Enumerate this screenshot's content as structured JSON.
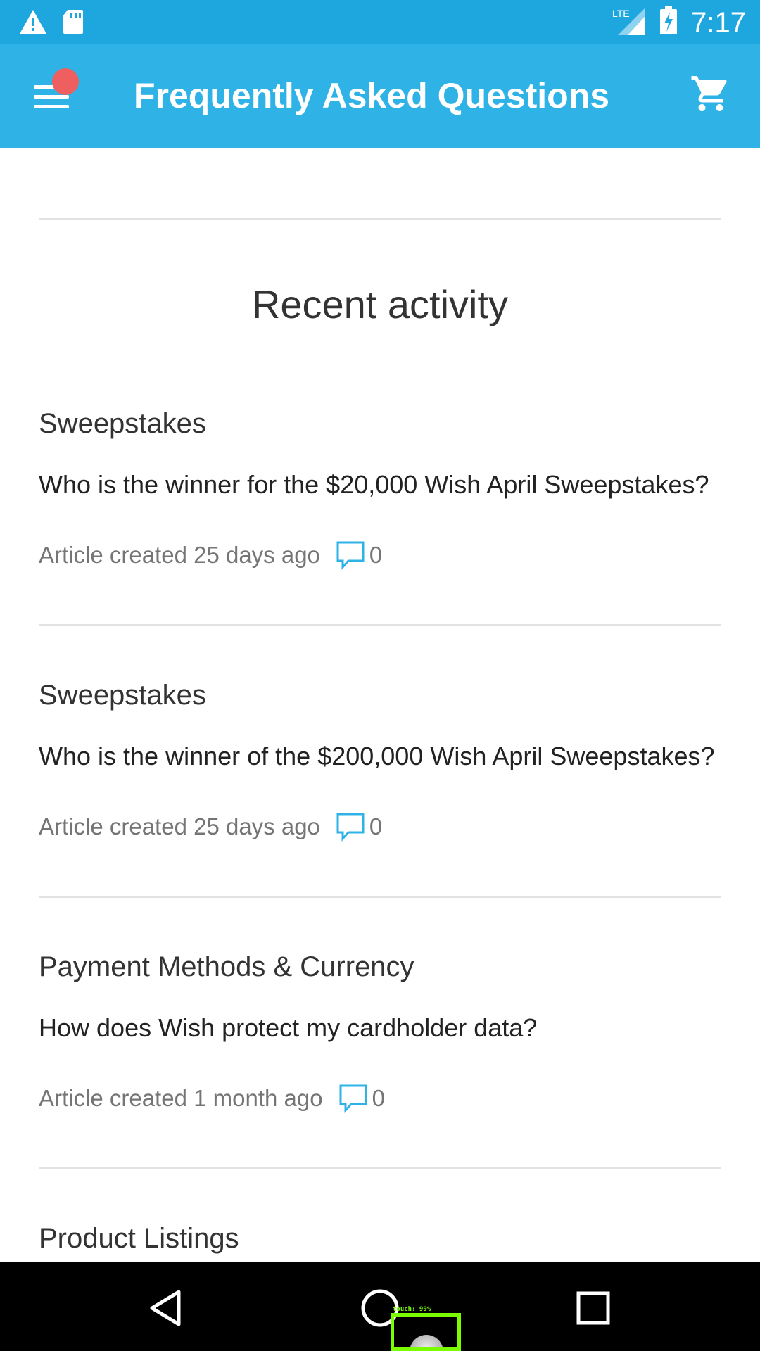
{
  "status_bar": {
    "time": "7:17",
    "network": "LTE",
    "icons": [
      "warning-icon",
      "sd-card-icon",
      "lte-signal-icon",
      "battery-charging-icon"
    ]
  },
  "app_bar": {
    "title": "Frequently Asked Questions",
    "menu_icon": "hamburger-menu-icon",
    "cart_icon": "shopping-cart-icon",
    "notification_dot_color": "#ef5f60"
  },
  "main": {
    "section_title": "Recent activity",
    "articles": [
      {
        "category": "Sweepstakes",
        "question": "Who is the winner for the $20,000 Wish April Sweepstakes?",
        "meta": "Article created 25 days ago",
        "comment_count": "0"
      },
      {
        "category": "Sweepstakes",
        "question": "Who is the winner of the $200,000 Wish April Sweepstakes?",
        "meta": "Article created 25 days ago",
        "comment_count": "0"
      },
      {
        "category": "Payment Methods & Currency",
        "question": "How does Wish protect my cardholder data?",
        "meta": "Article created 1 month ago",
        "comment_count": "0"
      },
      {
        "category": "Product Listings"
      }
    ]
  },
  "nav_bar": {
    "icons": [
      "back-icon",
      "home-icon",
      "recents-icon"
    ]
  },
  "touch_indicator": {
    "label": "touch: 99%"
  },
  "colors": {
    "status_bar": "#1ea6de",
    "app_bar": "#2fb3e6",
    "accent": "#2fb3e6"
  }
}
